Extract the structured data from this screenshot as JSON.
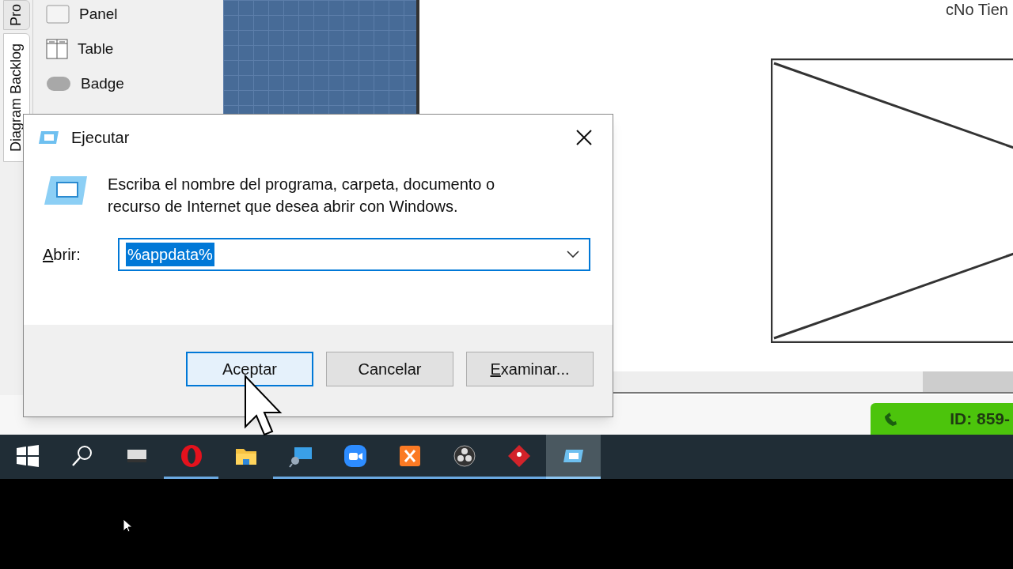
{
  "side_tabs": [
    {
      "label": "Pro",
      "selected": false
    },
    {
      "label": "Diagram Backlog",
      "selected": true
    }
  ],
  "palette": {
    "items": [
      {
        "kind": "panel",
        "label": "Panel"
      },
      {
        "kind": "table",
        "label": "Table"
      },
      {
        "kind": "badge",
        "label": "Badge"
      }
    ]
  },
  "canvas": {
    "heading": "cNo Tien",
    "image_placeholder": {
      "kind": "wireframe"
    }
  },
  "status_badge": {
    "text": "ID: 859-",
    "color": "#4cc40c"
  },
  "dialog": {
    "title": "Ejecutar",
    "message": "Escriba el nombre del programa, carpeta, documento o recurso de Internet que desea abrir con Windows.",
    "field": {
      "label": "Abrir:",
      "mnemonic": true,
      "value": "%appdata%",
      "selected": true
    },
    "buttons": [
      {
        "label": "Aceptar",
        "mnemonic": false,
        "focused": true
      },
      {
        "label": "Cancelar",
        "mnemonic": false,
        "focused": false
      },
      {
        "label": "Examinar...",
        "mnemonic": true,
        "focused": false
      }
    ]
  },
  "taskbar": {
    "items": [
      {
        "kind": "start",
        "running": false,
        "selected": false
      },
      {
        "kind": "search",
        "running": false,
        "selected": false
      },
      {
        "kind": "window",
        "running": false,
        "selected": false
      },
      {
        "kind": "opera",
        "running": true,
        "selected": false
      },
      {
        "kind": "folder",
        "running": false,
        "selected": false
      },
      {
        "kind": "remote",
        "running": true,
        "selected": false
      },
      {
        "kind": "zoom",
        "running": true,
        "selected": false
      },
      {
        "kind": "xampp",
        "running": true,
        "selected": false
      },
      {
        "kind": "obs",
        "running": true,
        "selected": false
      },
      {
        "kind": "git",
        "running": true,
        "selected": false
      },
      {
        "kind": "run",
        "running": true,
        "selected": true
      }
    ]
  }
}
